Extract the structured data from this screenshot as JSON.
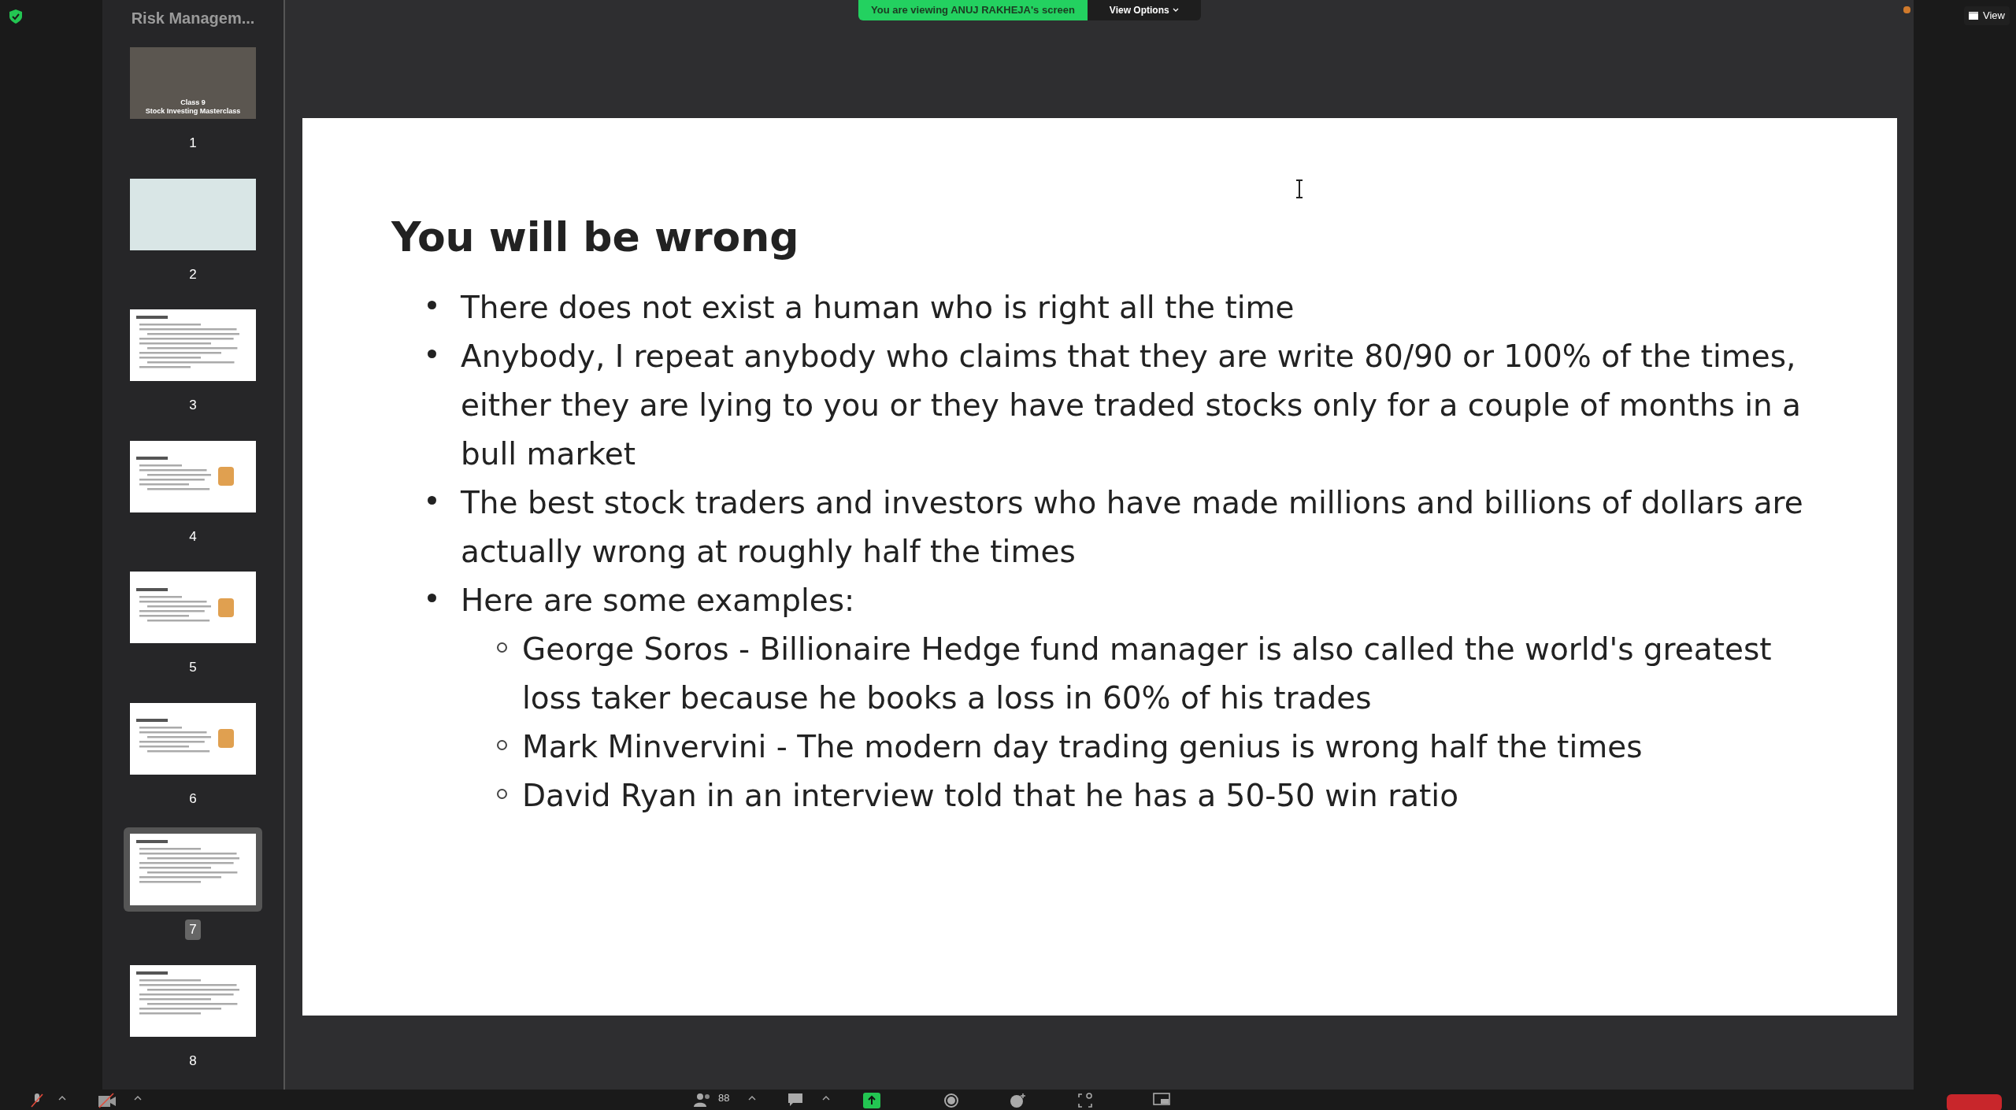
{
  "banner": {
    "text": "You are viewing ANUJ RAKHEJA's screen",
    "view_options": "View Options"
  },
  "view_button": "View",
  "sidebar": {
    "title": "Risk Managem...",
    "thumbnails": [
      {
        "number": "1",
        "kind": "cover",
        "lines": [
          "Class 9",
          "Stock Investing Masterclass"
        ],
        "selected": false
      },
      {
        "number": "2",
        "kind": "photo",
        "selected": false
      },
      {
        "number": "3",
        "kind": "text",
        "selected": false
      },
      {
        "number": "4",
        "kind": "text_figure",
        "selected": false
      },
      {
        "number": "5",
        "kind": "text_figure",
        "selected": false
      },
      {
        "number": "6",
        "kind": "text_figure",
        "selected": false
      },
      {
        "number": "7",
        "kind": "text",
        "selected": true
      },
      {
        "number": "8",
        "kind": "text",
        "selected": false
      }
    ]
  },
  "slide": {
    "title": "You will be wrong",
    "bullets": [
      {
        "text": "There does not exist a human who is right all the time"
      },
      {
        "text": "Anybody, I repeat anybody who claims that they are write 80/90 or 100% of the times, either they are lying to you or they have traded stocks only for a couple of months in a bull market"
      },
      {
        "text": "The best stock traders and investors who have made millions and billions of dollars are actually wrong at roughly half the times"
      },
      {
        "text": "Here are some examples:",
        "children": [
          {
            "text": "George Soros - Billionaire Hedge fund manager is also called the world's greatest loss taker because he books a loss in 60% of his trades"
          },
          {
            "text": "Mark Minvervini - The modern day trading genius is wrong half the times"
          },
          {
            "text": "David Ryan in an interview told that he has a 50-50 win ratio"
          }
        ]
      }
    ]
  },
  "toolbar": {
    "participants_count": "88"
  }
}
